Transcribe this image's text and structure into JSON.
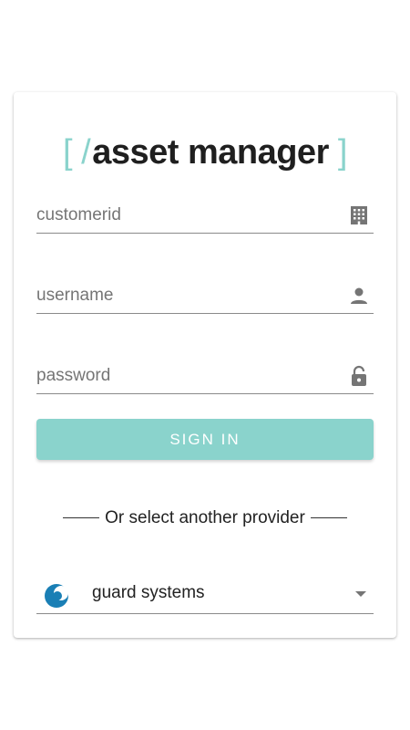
{
  "logo": {
    "bracket_open": "[",
    "slash": "/",
    "name": "asset manager",
    "bracket_close": "]"
  },
  "form": {
    "customerid_placeholder": "customerid",
    "username_placeholder": "username",
    "password_placeholder": "password",
    "signin_label": "SIGN IN"
  },
  "divider_text": "Or select another provider",
  "provider": {
    "selected": "guard systems"
  },
  "icons": {
    "customerid": "building-icon",
    "username": "person-icon",
    "password": "lock-icon",
    "provider": "provider-logo",
    "dropdown": "caret-down-icon"
  },
  "colors": {
    "accent": "#8ad3cc",
    "provider_logo": "#1a7fb5"
  }
}
